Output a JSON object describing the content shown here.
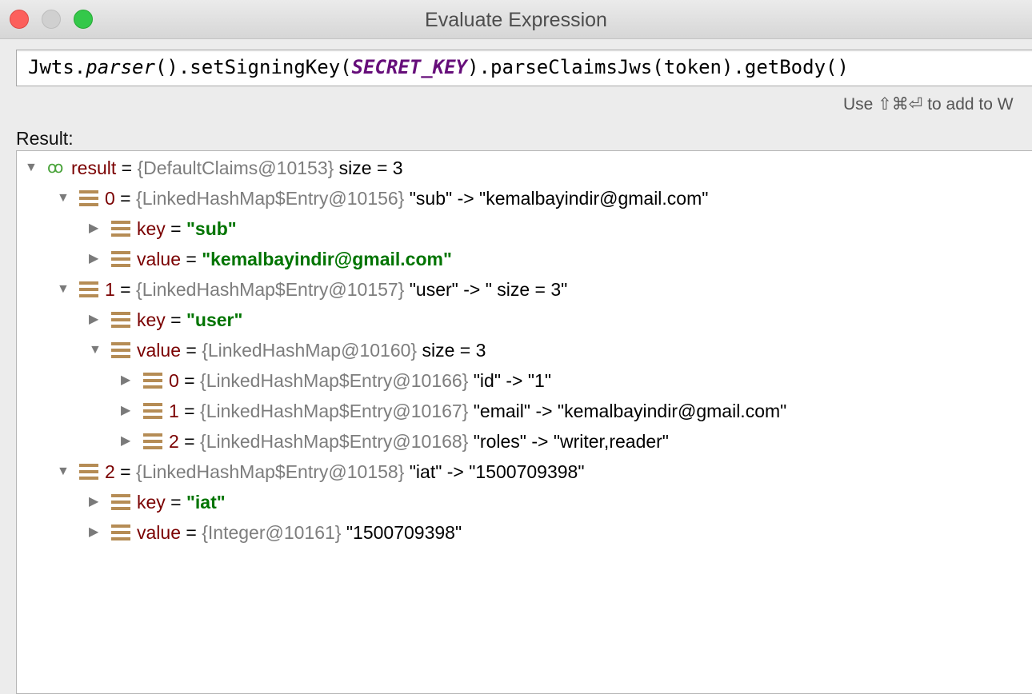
{
  "window": {
    "title": "Evaluate Expression"
  },
  "expression": {
    "part1": "Jwts.",
    "part2": "parser",
    "part3": "().setSigningKey(",
    "part4": "SECRET_KEY",
    "part5": ").parseClaimsJws(token).getBody()"
  },
  "hint": "Use ⇧⌘⏎ to add to W",
  "result_label": "Result:",
  "tree": [
    {
      "arrow": "▼",
      "icon": "glasses-icon",
      "name": "result",
      "eq": " = ",
      "type": "{DefaultClaims@10153}",
      "value": "  size = 3",
      "value_style": "plain"
    },
    {
      "arrow": "▼",
      "icon": "field-icon",
      "name": "0",
      "eq": " = ",
      "type": "{LinkedHashMap$Entry@10156}",
      "value": " \"sub\" -> \"kemalbayindir@gmail.com\"",
      "value_style": "plain"
    },
    {
      "arrow": "▶",
      "icon": "field-icon",
      "name": "key",
      "eq": " = ",
      "type": "",
      "value": "\"sub\"",
      "value_style": "string"
    },
    {
      "arrow": "▶",
      "icon": "field-icon",
      "name": "value",
      "eq": " = ",
      "type": "",
      "value": "\"kemalbayindir@gmail.com\"",
      "value_style": "string"
    },
    {
      "arrow": "▼",
      "icon": "field-icon",
      "name": "1",
      "eq": " = ",
      "type": "{LinkedHashMap$Entry@10157}",
      "value": " \"user\" -> \" size = 3\"",
      "value_style": "plain"
    },
    {
      "arrow": "▶",
      "icon": "field-icon",
      "name": "key",
      "eq": " = ",
      "type": "",
      "value": "\"user\"",
      "value_style": "string"
    },
    {
      "arrow": "▼",
      "icon": "field-icon",
      "name": "value",
      "eq": " = ",
      "type": "{LinkedHashMap@10160}",
      "value": "  size = 3",
      "value_style": "plain"
    },
    {
      "arrow": "▶",
      "icon": "field-icon",
      "name": "0",
      "eq": " = ",
      "type": "{LinkedHashMap$Entry@10166}",
      "value": " \"id\" -> \"1\"",
      "value_style": "plain"
    },
    {
      "arrow": "▶",
      "icon": "field-icon",
      "name": "1",
      "eq": " = ",
      "type": "{LinkedHashMap$Entry@10167}",
      "value": " \"email\" -> \"kemalbayindir@gmail.com\"",
      "value_style": "plain"
    },
    {
      "arrow": "▶",
      "icon": "field-icon",
      "name": "2",
      "eq": " = ",
      "type": "{LinkedHashMap$Entry@10168}",
      "value": " \"roles\" -> \"writer,reader\"",
      "value_style": "plain"
    },
    {
      "arrow": "▼",
      "icon": "field-icon",
      "name": "2",
      "eq": " = ",
      "type": "{LinkedHashMap$Entry@10158}",
      "value": " \"iat\" -> \"1500709398\"",
      "value_style": "plain"
    },
    {
      "arrow": "▶",
      "icon": "field-icon",
      "name": "key",
      "eq": " = ",
      "type": "",
      "value": "\"iat\"",
      "value_style": "string"
    },
    {
      "arrow": "▶",
      "icon": "field-icon",
      "name": "value",
      "eq": " = ",
      "type": "{Integer@10161}",
      "value": " \"1500709398\"",
      "value_style": "plain"
    }
  ]
}
